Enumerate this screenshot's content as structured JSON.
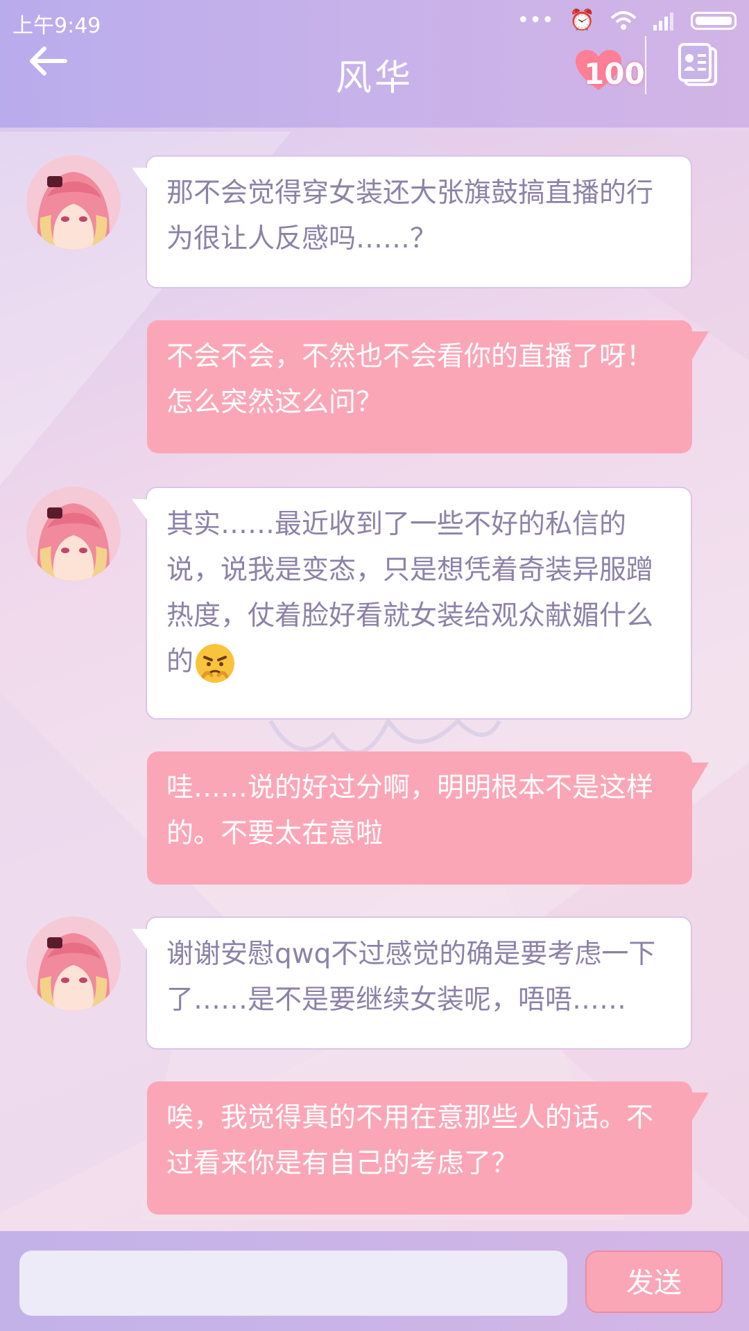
{
  "status_bar": {
    "time": "上午9:49",
    "icons": [
      "more-icon",
      "alarm-icon",
      "wifi-icon",
      "signal-icon",
      "battery-icon"
    ]
  },
  "header": {
    "title": "风华",
    "affinity_count": "100"
  },
  "messages": [
    {
      "from": "contact",
      "text": "那不会觉得穿女装还大张旗鼓搞直播的行为很让人反感吗……？"
    },
    {
      "from": "me",
      "text": "不会不会，不然也不会看你的直播了呀！怎么突然这么问？"
    },
    {
      "from": "contact",
      "text": "其实……最近收到了一些不好的私信的说，说我是变态，只是想凭着奇装异服蹭热度，仗着脸好看就女装给观众献媚什么的",
      "emoji": "worried-face-icon"
    },
    {
      "from": "me",
      "text": "哇……说的好过分啊，明明根本不是这样的。不要太在意啦"
    },
    {
      "from": "contact",
      "text": "谢谢安慰qwq不过感觉的确是要考虑一下了……是不是要继续女装呢，唔唔……"
    },
    {
      "from": "me",
      "text": "唉，我觉得真的不用在意那些人的话。不过看来你是有自己的考虑了？"
    }
  ],
  "input": {
    "value": "",
    "placeholder": ""
  },
  "send_button": {
    "label": "发送"
  },
  "colors": {
    "header": "#c8b2ea",
    "outgoing_bubble": "#fba6b7",
    "incoming_text": "#8c82a8",
    "heart": "#ff7f96"
  }
}
